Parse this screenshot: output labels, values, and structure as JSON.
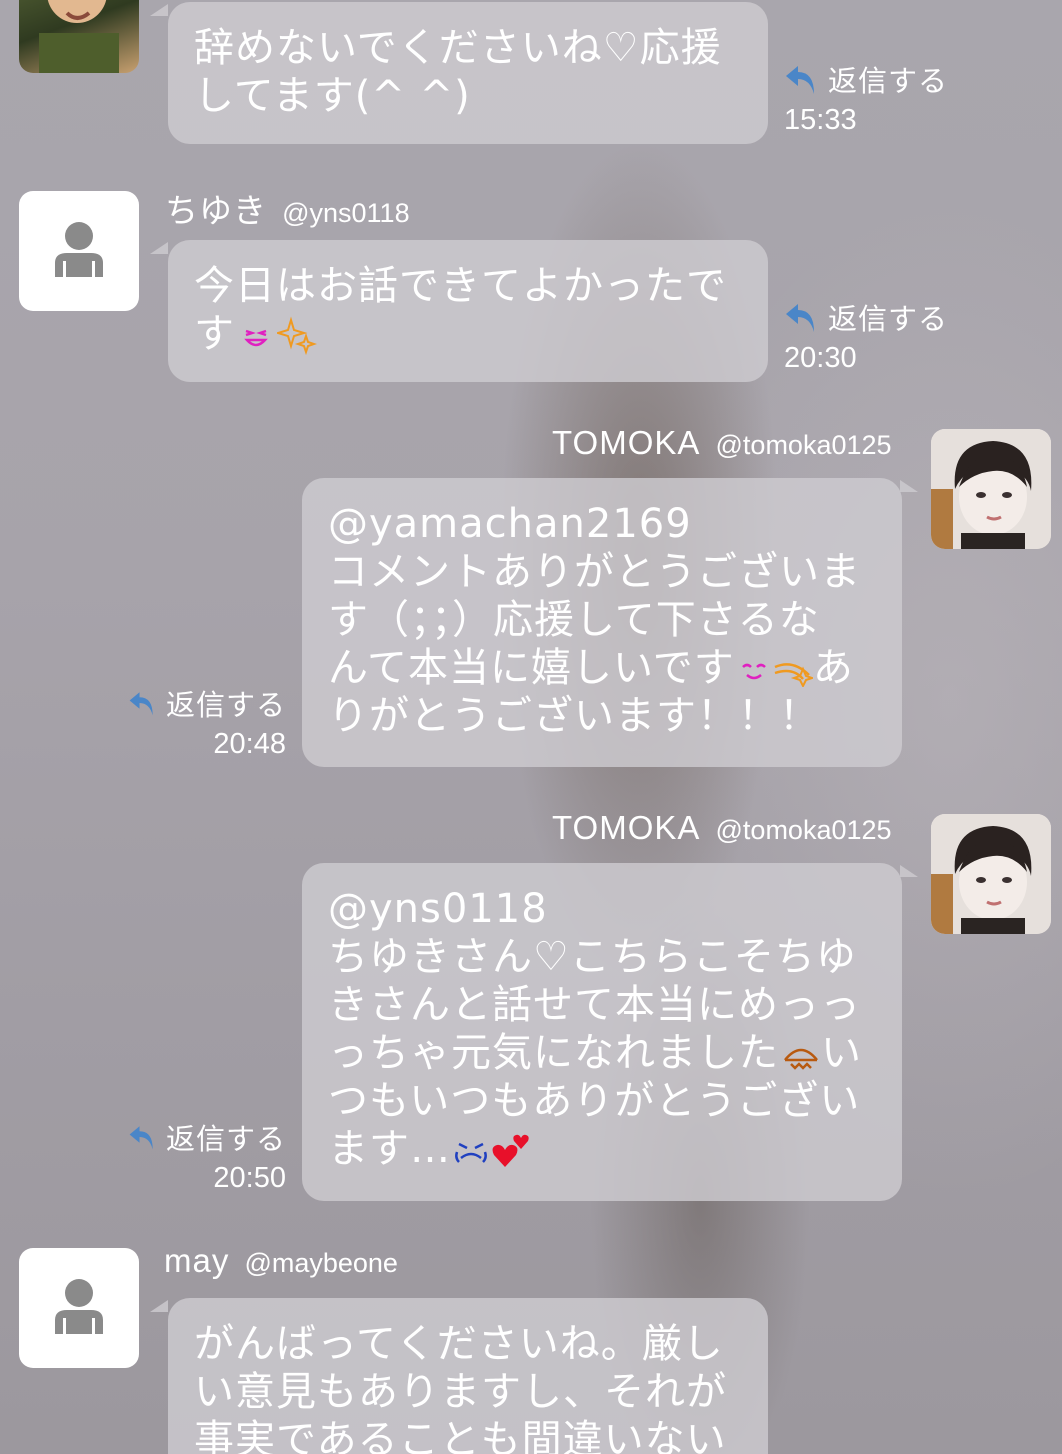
{
  "colors": {
    "bubble": "#cdcad0",
    "text": "#ffffff",
    "reply_icon": "#4a86c8",
    "heart": "#e8102a",
    "emoji_magenta": "#e020c0",
    "emoji_orange": "#f09a20",
    "emoji_blue": "#2040c0"
  },
  "messages": [
    {
      "id": "m1",
      "avatar": "child-photo",
      "lines": [
        "辞めないでくださいね♡応援",
        "してます(^ ^)"
      ],
      "reply_label": "返信する",
      "time": "15:33"
    },
    {
      "id": "m2",
      "name": "ちゆき",
      "handle": "@yns0118",
      "avatar": "default-person-icon",
      "lines": [
        "今日はお話できてよかったで",
        "す"
      ],
      "emojis": [
        "grinning-face-icon",
        "sparkles-icon"
      ],
      "reply_label": "返信する",
      "time": "20:30"
    },
    {
      "id": "m3",
      "name": "TOMOKA",
      "handle": "@tomoka0125",
      "avatar": "tomoka-photo",
      "lines": [
        "@yamachan2169",
        "コメントありがとうございま",
        "す（；；）応援して下さるな",
        "んて本当に嬉しいです",
        "りがとうございます！！！"
      ],
      "line4_suffix": "あ",
      "emojis": [
        "smiling-face-icon",
        "shooting-star-icon"
      ],
      "reply_label": "返信する",
      "time": "20:48"
    },
    {
      "id": "m4",
      "name": "TOMOKA",
      "handle": "@tomoka0125",
      "avatar": "tomoka-photo",
      "lines": [
        "@yns0118",
        "ちゆきさん♡こちらこそちゆ",
        "きさんと話せて本当にめっっ",
        "っちゃ元気になれました",
        "つもいつもありがとうござい",
        "ます…"
      ],
      "line4_suffix": "い",
      "emojis": [
        "bowing-face-icon",
        "crying-face-icon",
        "two-hearts-icon"
      ],
      "reply_label": "返信する",
      "time": "20:50"
    },
    {
      "id": "m5",
      "name": "may",
      "handle": "@maybeone",
      "avatar": "default-person-icon",
      "lines": [
        "がんばってくださいね。厳し",
        "い意見もありますし、それが",
        "事実であることも間違いない"
      ]
    }
  ]
}
